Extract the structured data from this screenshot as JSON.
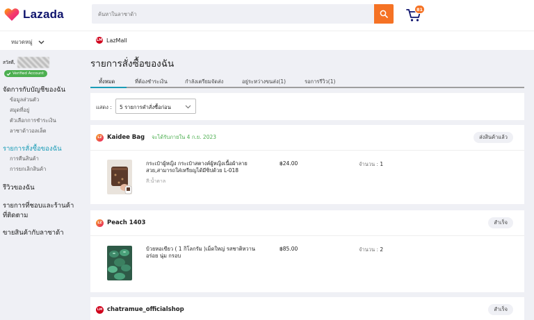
{
  "header": {
    "logo_text": "Lazada",
    "search_placeholder": "ค้นหาในลาซาด้า",
    "cart_count": "81",
    "brand_color": "#f57224"
  },
  "subbar": {
    "category_label": "หมวดหมู่",
    "lazmall_label": "LazMall"
  },
  "sidebar": {
    "greeting": "สวัสดี,",
    "verified_label": "Verified Account",
    "account_title": "จัดการกับบัญชีของฉัน",
    "account_items": [
      "ข้อมูลส่วนตัว",
      "สมุดที่อยู่",
      "ตัวเลือกการชำระเงิน",
      "ลาซาด้าวอลเล็ต"
    ],
    "orders_title": "รายการสั่งซื้อของฉัน",
    "orders_items": [
      "การคืนสินค้า",
      "การยกเลิกสินค้า"
    ],
    "reviews_title": "รีวิวของฉัน",
    "wishlist_title_line1": "รายการที่ชอบและร้านค้า",
    "wishlist_title_line2": "ที่ติดตาม",
    "sell_title": "ขายสินค้ากับลาซาด้า"
  },
  "main": {
    "page_title": "รายการสั่งซื้อของฉัน",
    "tabs": [
      {
        "label": "ทั้งหมด"
      },
      {
        "label": "ที่ต้องชำระเงิน"
      },
      {
        "label": "กำลังเตรียมจัดส่ง"
      },
      {
        "label": "อยู่ระหว่างขนส่ง(1)"
      },
      {
        "label": "รอการรีวิว(1)"
      }
    ],
    "show_label": "แสดง :",
    "show_value": "5 รายการคำสั่งซื้อก่อน"
  },
  "orders": [
    {
      "shop_name": "Kaidee Bag",
      "delivery_note": "จะได้รับภายใน 4 ก.ย. 2023",
      "status": "ส่งสินค้าแล้ว",
      "item_title": "กระเป๋าผู้หญิง กระเป๋าสตางค์ผู้หญิงเนื้อผ้าลายสวย,สามารถใส่เหรียญได้มีซิปด้วย L-018",
      "item_variant": "สี:น้ำตาล",
      "price": "฿24.00",
      "qty_label": "จำนวน :",
      "qty": "1"
    },
    {
      "shop_name": "Peach 1403",
      "status": "สำเร็จ",
      "item_title": "บ้วยหอเขียว ( 1 กิโลกรัม )เม็ดใหญ่ รสชาติหวาน อร่อย นุ่ม กรอบ",
      "price": "฿85.00",
      "qty_label": "จำนวน :",
      "qty": "2"
    },
    {
      "shop_name": "chatramue_officialshop",
      "status": "สำเร็จ"
    }
  ]
}
